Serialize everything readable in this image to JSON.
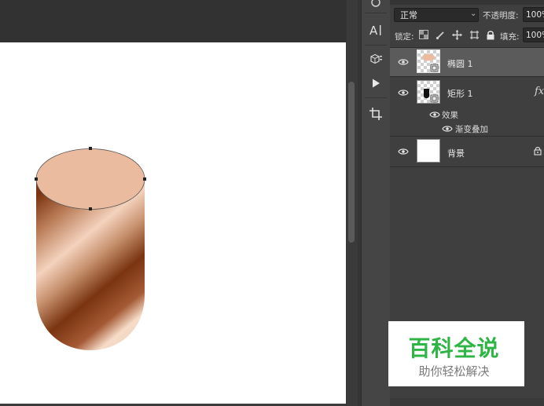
{
  "layers_panel": {
    "blend_mode": "正常",
    "opacity_label": "不透明度:",
    "opacity_value": "100%",
    "lock_label": "锁定:",
    "fill_label": "填充:",
    "fill_value": "100%",
    "layers": [
      {
        "name": "椭圆 1",
        "selected": true,
        "thumbnail": "checker-with-ellipse"
      },
      {
        "name": "矩形 1",
        "fx_label": "fx",
        "effects_label": "效果",
        "effect_items": [
          "渐变叠加"
        ],
        "thumbnail": "checker-with-rect"
      },
      {
        "name": "背景",
        "locked": true,
        "thumbnail": "white"
      }
    ]
  },
  "toolbar_icons": [
    "character-panel-icon",
    "3d-object-icon",
    "play-actions-icon",
    "crop-icon"
  ],
  "watermark": {
    "title": "百科全说",
    "subtitle": "助你轻松解决",
    "title_color": "#2eb545"
  },
  "canvas": {
    "shape_colors": {
      "ellipse_fill": "#ebbb9f",
      "gradient_dark": "#7a3410",
      "gradient_light": "#f6d6c1"
    }
  }
}
